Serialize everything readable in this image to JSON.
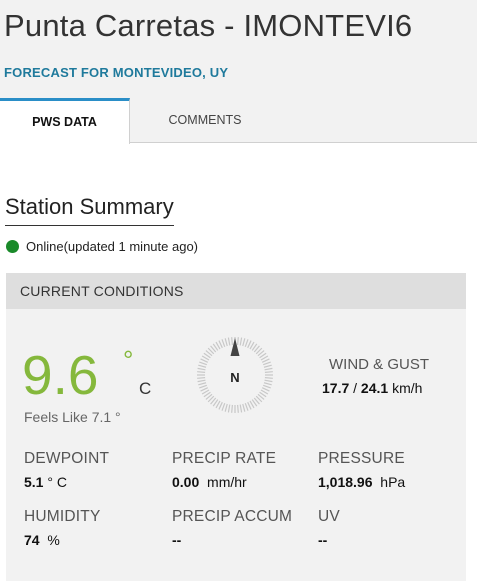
{
  "header": {
    "title": "Punta Carretas - IMONTEVI6",
    "subtitle": "FORECAST FOR MONTEVIDEO, UY"
  },
  "tabs": [
    {
      "label": "PWS DATA",
      "active": true
    },
    {
      "label": "COMMENTS",
      "active": false
    }
  ],
  "station": {
    "title": "Station Summary",
    "status_text": "Online(updated 1 minute ago)",
    "status_color": "#1a8a2a"
  },
  "conditions": {
    "header": "CURRENT CONDITIONS",
    "temperature": "9.6",
    "degree_symbol": "°",
    "temp_unit": "C",
    "feels_like": "Feels Like 7.1 °",
    "compass_direction": "N",
    "wind_label": "WIND & GUST",
    "wind_speed": "17.7",
    "wind_sep": " / ",
    "gust_speed": "24.1",
    "wind_unit": "km/h",
    "dewpoint_label": "DEWPOINT",
    "dewpoint_value": "5.1",
    "dewpoint_unit": "° C",
    "precip_rate_label": "PRECIP RATE",
    "precip_rate_value": "0.00",
    "precip_rate_unit": "mm/hr",
    "pressure_label": "PRESSURE",
    "pressure_value": "1,018.96",
    "pressure_unit": "hPa",
    "humidity_label": "HUMIDITY",
    "humidity_value": "74",
    "humidity_unit": "%",
    "precip_accum_label": "PRECIP ACCUM",
    "precip_accum_value": "--",
    "uv_label": "UV",
    "uv_value": "--"
  },
  "colors": {
    "accent": "#2a8ec7",
    "subtitle": "#1f7a9c",
    "temperature": "#85b83c"
  }
}
